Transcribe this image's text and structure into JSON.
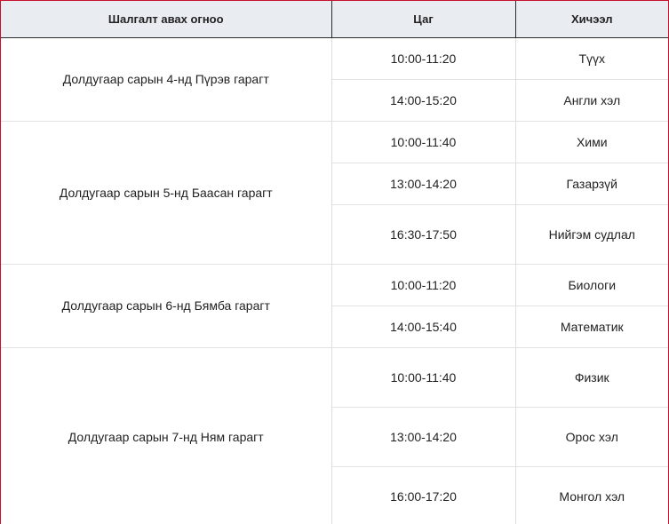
{
  "headers": {
    "day": "Шалгалт авах огноо",
    "time": "Цаг",
    "subject": "Хичээл"
  },
  "days": [
    {
      "label": "Долдугаар сарын 4-нд Пүрэв гарагт",
      "rows": [
        {
          "time": "10:00-11:20",
          "subject": "Түүх"
        },
        {
          "time": "14:00-15:20",
          "subject": "Англи хэл"
        }
      ]
    },
    {
      "label": "Долдугаар сарын 5-нд Баасан гарагт",
      "rows": [
        {
          "time": "10:00-11:40",
          "subject": "Хими"
        },
        {
          "time": "13:00-14:20",
          "subject": "Газарзүй"
        },
        {
          "time": "16:30-17:50",
          "subject": "Нийгэм судлал"
        }
      ]
    },
    {
      "label": "Долдугаар сарын 6-нд Бямба гарагт",
      "rows": [
        {
          "time": "10:00-11:20",
          "subject": "Биологи"
        },
        {
          "time": "14:00-15:40",
          "subject": "Математик"
        }
      ]
    },
    {
      "label": "Долдугаар сарын 7-нд Ням гарагт",
      "rows": [
        {
          "time": "10:00-11:40",
          "subject": "Физик"
        },
        {
          "time": "13:00-14:20",
          "subject": "Орос хэл"
        },
        {
          "time": "16:00-17:20",
          "subject": "Монгол хэл"
        }
      ]
    }
  ],
  "colors": {
    "header_bg": "#e9ecf1",
    "frame_border": "#c8102e"
  }
}
